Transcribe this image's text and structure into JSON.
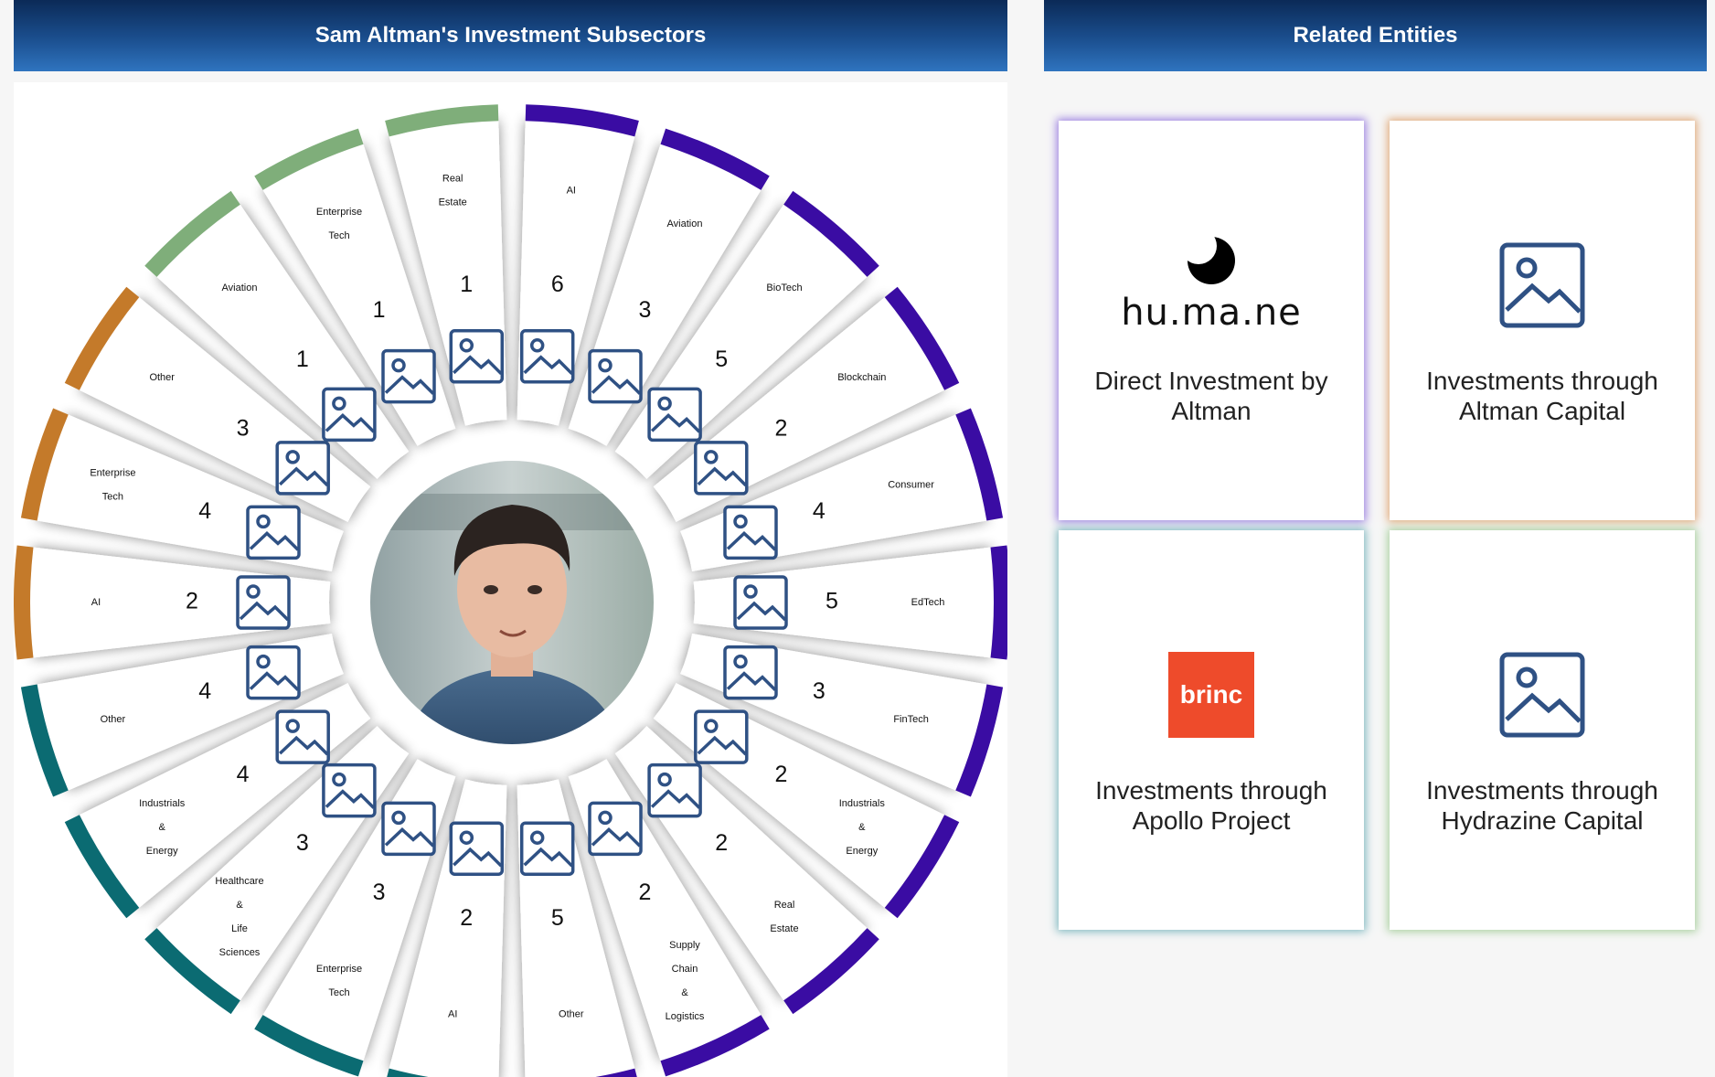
{
  "left_panel": {
    "title": "Sam Altman's Investment Subsectors",
    "segments": [
      {
        "label": [
          "AI"
        ],
        "count": "6",
        "color": "#3a0ca3"
      },
      {
        "label": [
          "Aviation"
        ],
        "count": "3",
        "color": "#3a0ca3"
      },
      {
        "label": [
          "BioTech"
        ],
        "count": "5",
        "color": "#3a0ca3"
      },
      {
        "label": [
          "Blockchain"
        ],
        "count": "2",
        "color": "#3a0ca3"
      },
      {
        "label": [
          "Consumer"
        ],
        "count": "4",
        "color": "#3a0ca3"
      },
      {
        "label": [
          "EdTech"
        ],
        "count": "5",
        "color": "#3a0ca3"
      },
      {
        "label": [
          "FinTech"
        ],
        "count": "3",
        "color": "#3a0ca3"
      },
      {
        "label": [
          "Industrials",
          "&",
          "Energy"
        ],
        "count": "2",
        "color": "#3a0ca3"
      },
      {
        "label": [
          "Real",
          "Estate"
        ],
        "count": "2",
        "color": "#3a0ca3"
      },
      {
        "label": [
          "Supply",
          "Chain",
          "&",
          "Logistics"
        ],
        "count": "2",
        "color": "#3a0ca3"
      },
      {
        "label": [
          "Other"
        ],
        "count": "5",
        "color": "#3a0ca3"
      },
      {
        "label": [
          "AI"
        ],
        "count": "2",
        "color": "#0b6b72"
      },
      {
        "label": [
          "Enterprise",
          "Tech"
        ],
        "count": "3",
        "color": "#0b6b72"
      },
      {
        "label": [
          "Healthcare",
          "&",
          "Life",
          "Sciences"
        ],
        "count": "3",
        "color": "#0b6b72"
      },
      {
        "label": [
          "Industrials",
          "&",
          "Energy"
        ],
        "count": "4",
        "color": "#0b6b72"
      },
      {
        "label": [
          "Other"
        ],
        "count": "4",
        "color": "#0b6b72"
      },
      {
        "label": [
          "AI"
        ],
        "count": "2",
        "color": "#c47a2a"
      },
      {
        "label": [
          "Enterprise",
          "Tech"
        ],
        "count": "4",
        "color": "#c47a2a"
      },
      {
        "label": [
          "Other"
        ],
        "count": "3",
        "color": "#c47a2a"
      },
      {
        "label": [
          "Aviation"
        ],
        "count": "1",
        "color": "#7fae7a"
      },
      {
        "label": [
          "Enterprise",
          "Tech"
        ],
        "count": "1",
        "color": "#7fae7a"
      },
      {
        "label": [
          "Real",
          "Estate"
        ],
        "count": "1",
        "color": "#7fae7a"
      }
    ]
  },
  "right_panel": {
    "title": "Related Entities",
    "cards": [
      {
        "title": "Direct Investment by Altman",
        "logo": "humane-logo",
        "logo_text": "hu.ma.ne",
        "glow": "#9b7fe0"
      },
      {
        "title": "Investments through Altman Capital",
        "logo": "image-placeholder-icon",
        "glow": "#e0a978"
      },
      {
        "title": "Investments through Apollo Project",
        "logo": "brinc-logo",
        "logo_text": "brinc",
        "glow": "#7fb8c0"
      },
      {
        "title": "Investments through Hydrazine Capital",
        "logo": "image-placeholder-icon",
        "glow": "#a8cf9e"
      }
    ]
  }
}
